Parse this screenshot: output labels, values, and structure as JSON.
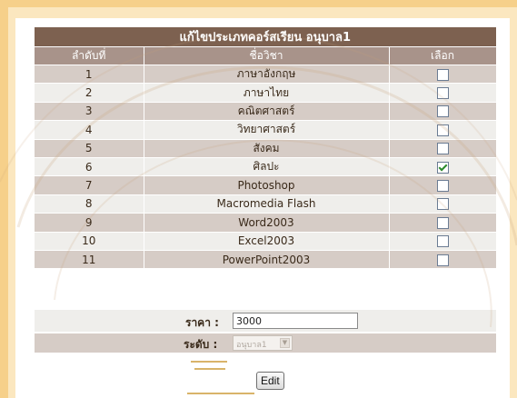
{
  "table": {
    "title": "แก้ไขประเภทคอร์สเรียน อนุบาล1",
    "headers": [
      "ลำดับที่",
      "ชื่อวิชา",
      "เลือก"
    ],
    "rows": [
      {
        "no": "1",
        "subject": "ภาษาอังกฤษ",
        "checked": false
      },
      {
        "no": "2",
        "subject": "ภาษาไทย",
        "checked": false
      },
      {
        "no": "3",
        "subject": "คณิตศาสตร์",
        "checked": false
      },
      {
        "no": "4",
        "subject": "วิทยาศาสตร์",
        "checked": false
      },
      {
        "no": "5",
        "subject": "สังคม",
        "checked": false
      },
      {
        "no": "6",
        "subject": "ศิลปะ",
        "checked": true
      },
      {
        "no": "7",
        "subject": "Photoshop",
        "checked": false
      },
      {
        "no": "8",
        "subject": "Macromedia Flash",
        "checked": false
      },
      {
        "no": "9",
        "subject": "Word2003",
        "checked": false
      },
      {
        "no": "10",
        "subject": "Excel2003",
        "checked": false
      },
      {
        "no": "11",
        "subject": "PowerPoint2003",
        "checked": false
      }
    ]
  },
  "form": {
    "price_label": "ราคา :",
    "price_value": "3000",
    "level_label": "ระดับ :",
    "level_selected": "อนุบาล1",
    "edit_label": "Edit"
  },
  "colors": {
    "title_bg": "#7d6150",
    "header_bg": "#a8938a",
    "row_dark": "#d6ccc6",
    "row_light": "#efeeeb",
    "frame": "#f6d08a"
  }
}
